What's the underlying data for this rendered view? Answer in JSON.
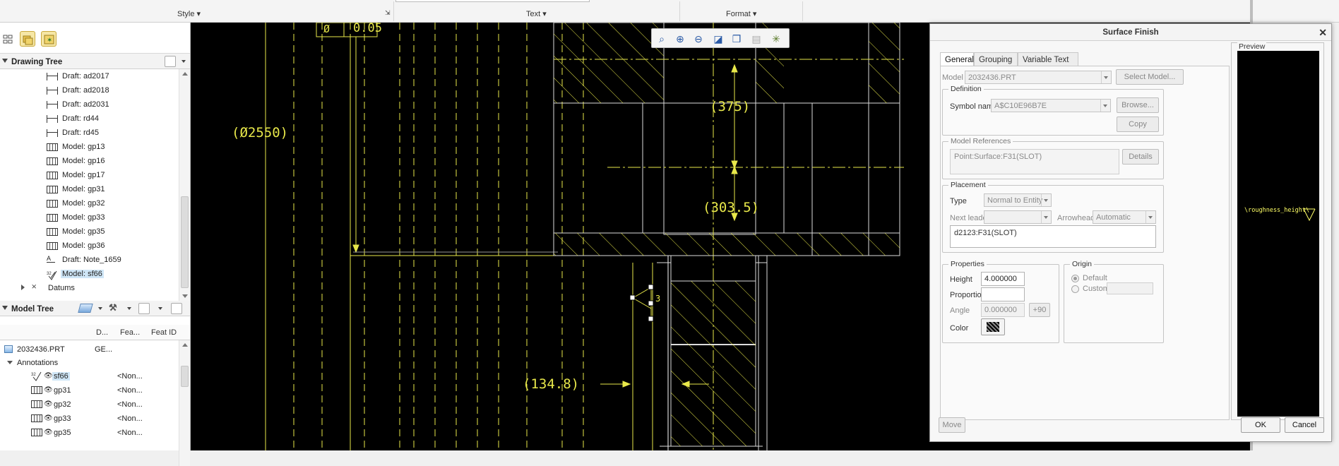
{
  "ribbon": {
    "groups": [
      "Style",
      "Text",
      "Format"
    ]
  },
  "drawing_tree": {
    "title": "Drawing Tree",
    "items": [
      {
        "label": "Draft: ad2017",
        "kind": "dim"
      },
      {
        "label": "Draft: ad2018",
        "kind": "dim"
      },
      {
        "label": "Draft: ad2031",
        "kind": "dim"
      },
      {
        "label": "Draft: rd44",
        "kind": "dim"
      },
      {
        "label": "Draft: rd45",
        "kind": "dim"
      },
      {
        "label": "Model: gp13",
        "kind": "model"
      },
      {
        "label": "Model: gp16",
        "kind": "model"
      },
      {
        "label": "Model: gp17",
        "kind": "model"
      },
      {
        "label": "Model: gp31",
        "kind": "model"
      },
      {
        "label": "Model: gp32",
        "kind": "model"
      },
      {
        "label": "Model: gp33",
        "kind": "model"
      },
      {
        "label": "Model: gp35",
        "kind": "model"
      },
      {
        "label": "Model: gp36",
        "kind": "model"
      },
      {
        "label": "Draft: Note_1659",
        "kind": "note"
      },
      {
        "label": "Model: sf66",
        "kind": "sf",
        "selected": true
      }
    ],
    "datums": "Datums"
  },
  "model_tree": {
    "title": "Model Tree",
    "columns": [
      "D...",
      "Fea...",
      "Feat ID"
    ],
    "root": {
      "label": "2032436.PRT",
      "col2": "GE..."
    },
    "annotations": "Annotations",
    "rows": [
      {
        "label": "sf66",
        "value": "<Non...",
        "selected": true
      },
      {
        "label": "gp31",
        "value": "<Non..."
      },
      {
        "label": "gp32",
        "value": "<Non..."
      },
      {
        "label": "gp33",
        "value": "<Non..."
      },
      {
        "label": "gp35",
        "value": "<Non..."
      }
    ]
  },
  "drawing": {
    "labels": {
      "d2550": "(Ø2550)",
      "d375": "(375)",
      "d303": "(303.5)",
      "d134": "(134.8)",
      "d005": "0.05",
      "dsym": "Ø",
      "d3": "3"
    }
  },
  "dialog": {
    "title": "Surface Finish",
    "tabs": [
      "General",
      "Grouping",
      "Variable Text"
    ],
    "model_label": "Model",
    "model_value": "2032436.PRT",
    "select_model": "Select Model...",
    "definition": "Definition",
    "symbol_name_label": "Symbol name",
    "symbol_name_value": "A$C10E96B7E",
    "browse": "Browse...",
    "copy": "Copy",
    "model_references": "Model References",
    "reference_value": "Point:Surface:F31(SLOT)",
    "details": "Details",
    "placement": "Placement",
    "type_label": "Type",
    "type_value": "Normal to Entity",
    "next_leader_label": "Next leader",
    "arrowhead_label": "Arrowhead",
    "arrowhead_value": "Automatic",
    "placement_ref": "d2123:F31(SLOT)",
    "properties": "Properties",
    "height_label": "Height",
    "height_value": "4.000000",
    "proportion_label": "Proportion",
    "angle_label": "Angle",
    "angle_value": "0.000000",
    "plus90": "+90",
    "color_label": "Color",
    "origin": "Origin",
    "origin_default": "Default",
    "origin_custom": "Custom",
    "preview": "Preview",
    "preview_text": "\\roughness_height\\",
    "move": "Move",
    "ok": "OK",
    "cancel": "Cancel"
  }
}
